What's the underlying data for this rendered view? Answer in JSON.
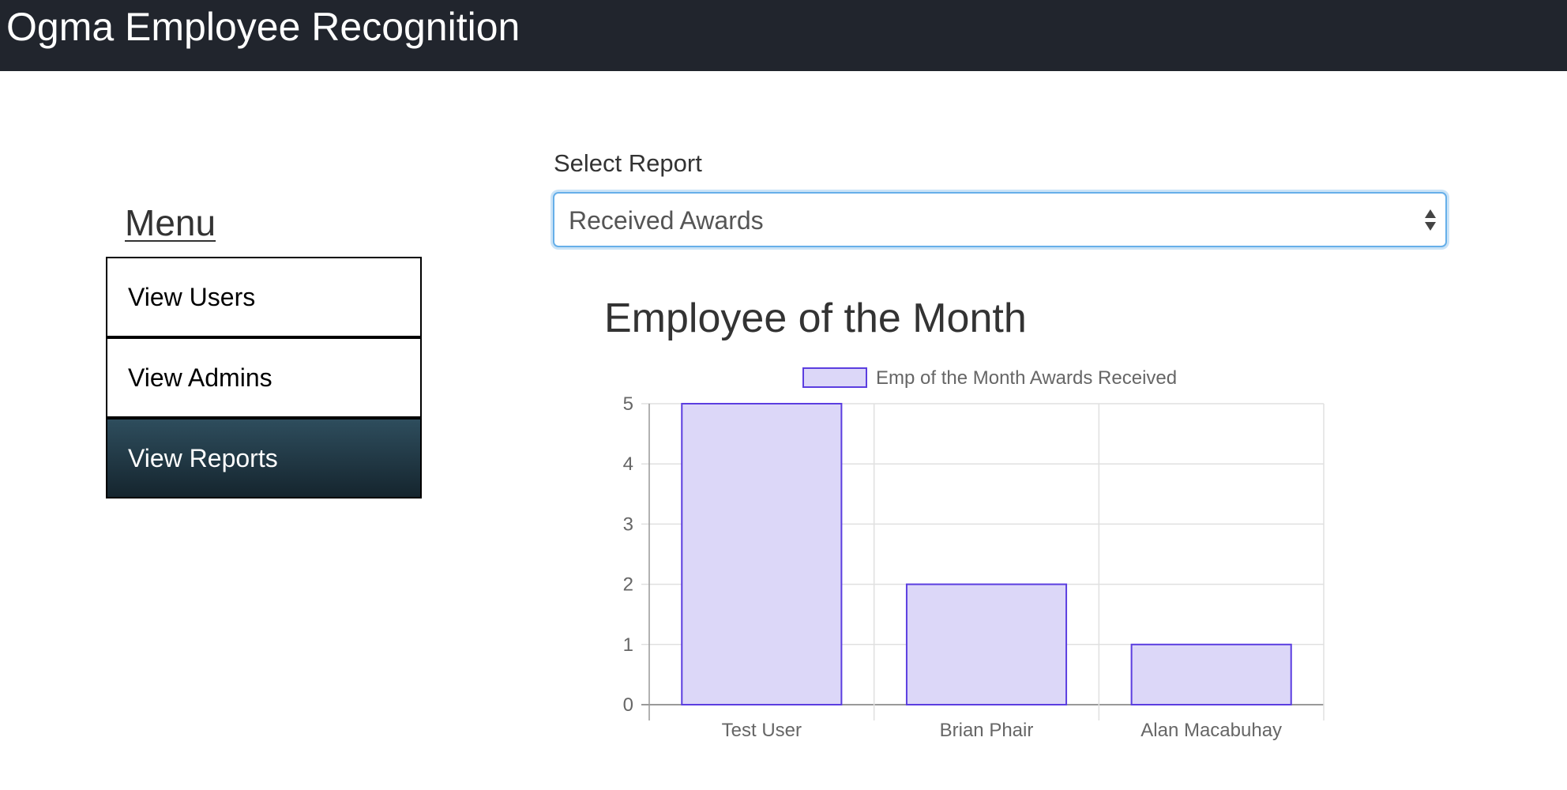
{
  "app": {
    "title": "Ogma Employee Recognition"
  },
  "menu": {
    "heading": "Menu",
    "items": [
      {
        "label": "View Users",
        "active": false
      },
      {
        "label": "View Admins",
        "active": false
      },
      {
        "label": "View Reports",
        "active": true
      }
    ]
  },
  "report": {
    "label": "Select Report",
    "selected": "Received Awards"
  },
  "chart_data": {
    "type": "bar",
    "title": "Employee of the Month",
    "categories": [
      "Test User",
      "Brian Phair",
      "Alan Macabuhay"
    ],
    "series": [
      {
        "name": "Emp of the Month Awards Received",
        "values": [
          5,
          2,
          1
        ]
      }
    ],
    "ylim": [
      0,
      5
    ],
    "yticks": [
      0,
      1,
      2,
      3,
      4,
      5
    ],
    "grid": true,
    "legend": "top-center",
    "colors": {
      "fill": "#dcd7f8",
      "stroke": "#5b3ee0",
      "grid": "#e0e0e0",
      "axis": "#999999"
    }
  }
}
